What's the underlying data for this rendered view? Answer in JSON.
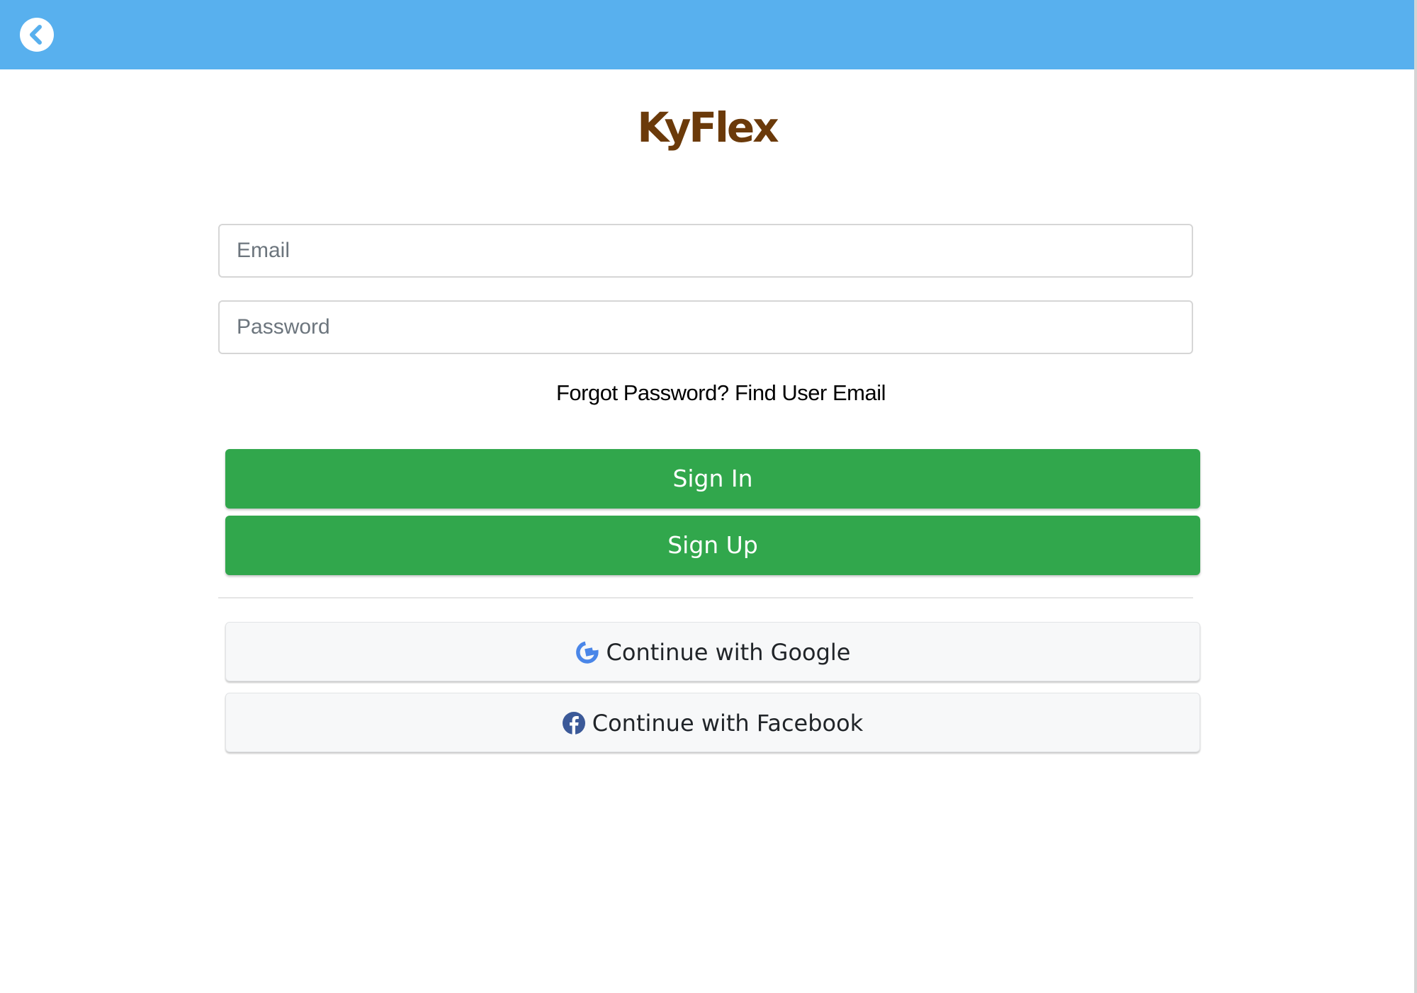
{
  "header": {
    "background_color": "#58b0ee",
    "back_icon": "chevron-left-circle-icon"
  },
  "app": {
    "title": "KyFlex",
    "title_color": "#6b3a0a"
  },
  "form": {
    "email_placeholder": "Email",
    "email_value": "",
    "password_placeholder": "Password",
    "password_value": ""
  },
  "links": {
    "forgot_password": "Forgot Password?",
    "find_user_email": "Find User Email"
  },
  "buttons": {
    "sign_in": "Sign In",
    "sign_up": "Sign Up",
    "primary_color": "#31a74c",
    "google": "Continue with Google",
    "google_icon": "google-icon",
    "facebook": "Continue with Facebook",
    "facebook_icon": "facebook-icon"
  }
}
